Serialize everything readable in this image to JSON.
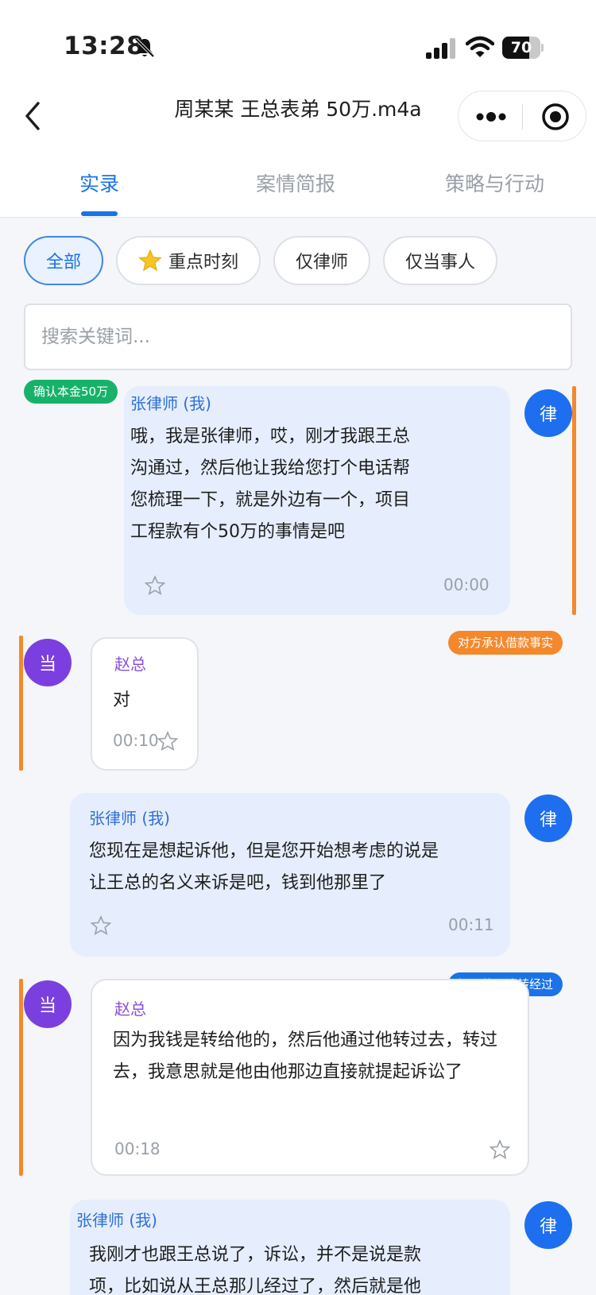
{
  "status_bar": {
    "time": "13:28",
    "battery": "70",
    "battery_level": 0.7
  },
  "header": {
    "title": "周某某 王总表弟 50万.m4a"
  },
  "tabs": [
    {
      "label": "实录",
      "active": true
    },
    {
      "label": "案情简报",
      "active": false
    },
    {
      "label": "策略与行动",
      "active": false
    }
  ],
  "filters": [
    {
      "label": "全部",
      "active": true
    },
    {
      "label": "重点时刻",
      "active": false
    },
    {
      "label": "仅律师",
      "active": false
    },
    {
      "label": "仅当事人",
      "active": false
    }
  ],
  "search": {
    "placeholder": "搜索关键词..."
  },
  "messages": [
    {
      "role": "lawyer",
      "avatar": "律",
      "speaker": "张律师 (我)",
      "text": "哦，我是张律师，哎，刚才我跟王总沟通过，然后他让我给您打个电话帮您梳理一下，就是外边有一个，项目工程款有个50万的事情是吧",
      "time": "00:00",
      "tag": "确认本金50万",
      "tag_color": "#17b26a"
    },
    {
      "role": "party",
      "avatar": "当",
      "speaker": "赵总",
      "text": "对",
      "time": "00:10",
      "tag": "对方承认借款事实",
      "tag_color": "#f4882b"
    },
    {
      "role": "lawyer",
      "avatar": "律",
      "speaker": "张律师 (我)",
      "text": "您现在是想起诉他，但是您开始想考虑的说是让王总的名义来诉是吧，钱到他那里了",
      "time": "00:11",
      "tag": "",
      "tag_color": ""
    },
    {
      "role": "party",
      "avatar": "当",
      "speaker": "赵总",
      "text": "因为我钱是转给他的，然后他通过他转过去，转过去，我意思就是他由他那边直接就提起诉讼了",
      "time": "00:18",
      "tag": "提及款项流转经过",
      "tag_color": "#1a73e8"
    },
    {
      "role": "lawyer",
      "avatar": "律",
      "speaker": "张律师 (我)",
      "text": "我刚才也跟王总说了，诉讼，并不是说是款项，比如说从王总那儿经过了，然后就是他",
      "time": "",
      "tag": "",
      "tag_color": ""
    }
  ],
  "colors": {
    "accent": "#1a73e8",
    "lawyer_avatar": "#1e6ff0",
    "party_avatar": "#7b3fe0",
    "highlight_bar": "#f4882b"
  }
}
